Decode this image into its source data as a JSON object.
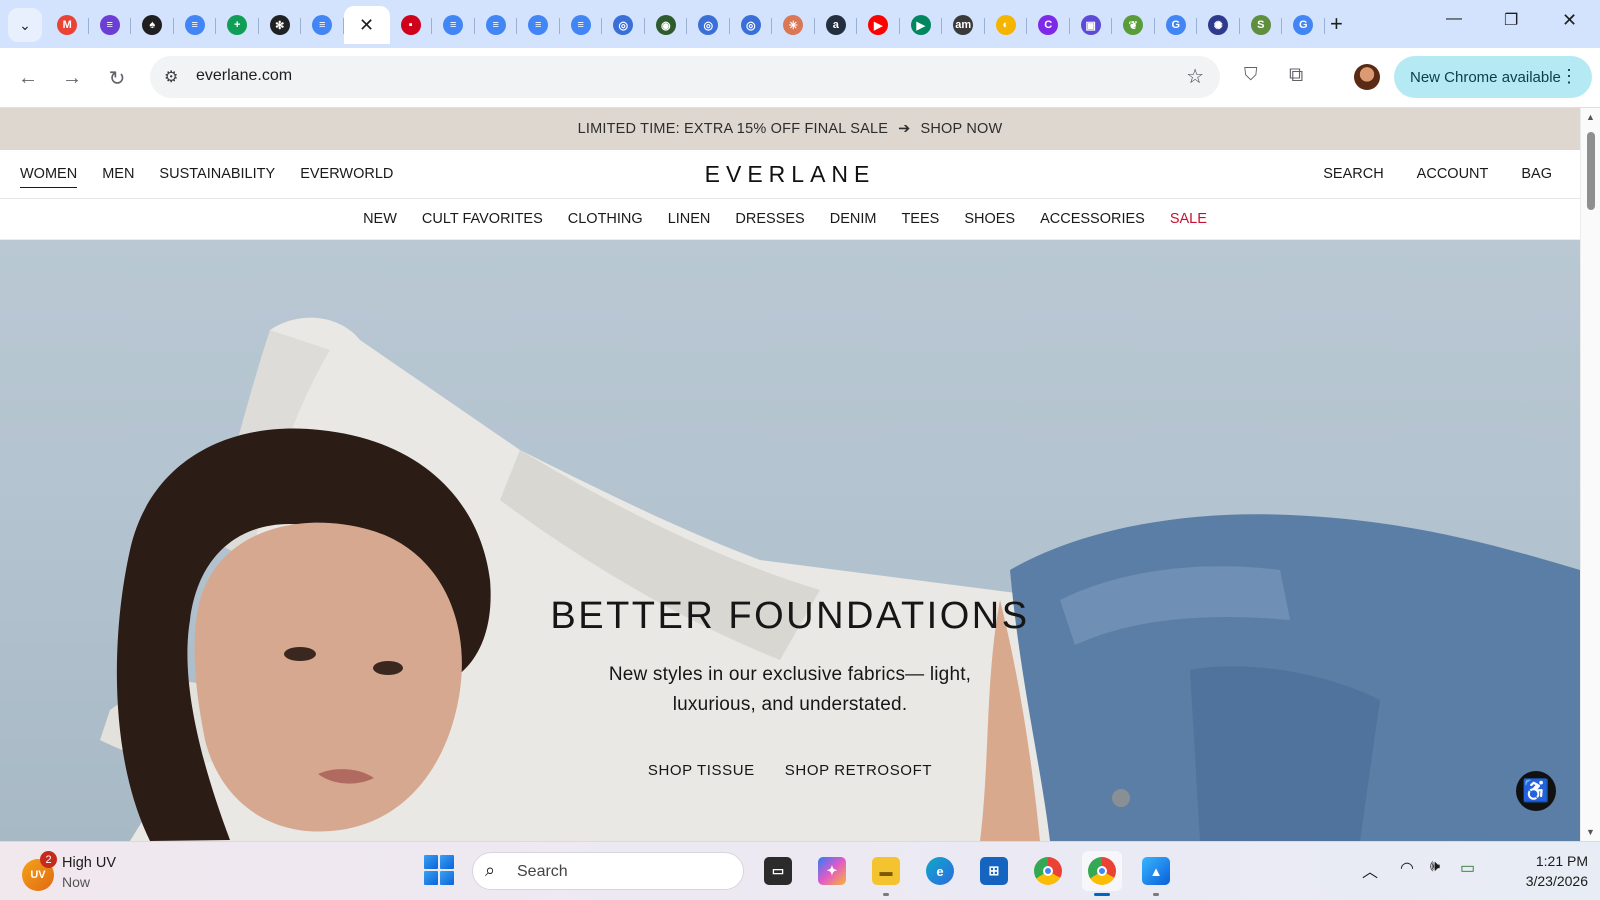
{
  "browser": {
    "tabs": [
      {
        "icon": "gmail-icon",
        "color": "#ea4335",
        "glyph": "M"
      },
      {
        "icon": "purple-app-icon",
        "color": "#6b3fd4",
        "glyph": "≡"
      },
      {
        "icon": "rocket-icon",
        "color": "#1f1f1f",
        "glyph": "♠"
      },
      {
        "icon": "google-docs-icon",
        "color": "#4285f4",
        "glyph": "≡"
      },
      {
        "icon": "google-sheets-icon",
        "color": "#0f9d58",
        "glyph": "+"
      },
      {
        "icon": "chatgpt-icon",
        "color": "#202123",
        "glyph": "✻"
      },
      {
        "icon": "google-docs-icon",
        "color": "#4285f4",
        "glyph": "≡"
      },
      {
        "icon": "active-tab-close-icon",
        "color": "",
        "glyph": "✕",
        "active": true
      },
      {
        "icon": "red-site-icon",
        "color": "#d0021b",
        "glyph": "▪"
      },
      {
        "icon": "google-docs-icon",
        "color": "#4285f4",
        "glyph": "≡"
      },
      {
        "icon": "google-docs-icon",
        "color": "#4285f4",
        "glyph": "≡"
      },
      {
        "icon": "google-docs-icon",
        "color": "#4285f4",
        "glyph": "≡"
      },
      {
        "icon": "google-docs-icon",
        "color": "#4285f4",
        "glyph": "≡"
      },
      {
        "icon": "globe-icon",
        "color": "#3b6fd8",
        "glyph": "◎"
      },
      {
        "icon": "seal-icon",
        "color": "#2d5b2d",
        "glyph": "◉"
      },
      {
        "icon": "globe-icon",
        "color": "#3b6fd8",
        "glyph": "◎"
      },
      {
        "icon": "globe-icon",
        "color": "#3b6fd8",
        "glyph": "◎"
      },
      {
        "icon": "claude-icon",
        "color": "#d97757",
        "glyph": "✳"
      },
      {
        "icon": "amazon-icon",
        "color": "#232f3e",
        "glyph": "a"
      },
      {
        "icon": "youtube-icon",
        "color": "#ff0000",
        "glyph": "▶"
      },
      {
        "icon": "google-play-icon",
        "color": "#01875f",
        "glyph": "▶"
      },
      {
        "icon": "amazon-music-icon",
        "color": "#3a3a3a",
        "glyph": "am"
      },
      {
        "icon": "yellow-app-icon",
        "color": "#f5b400",
        "glyph": "◐"
      },
      {
        "icon": "canva-icon",
        "color": "#7d2ae8",
        "glyph": "C"
      },
      {
        "icon": "printer-icon",
        "color": "#5b4bd6",
        "glyph": "▣"
      },
      {
        "icon": "leaf-icon",
        "color": "#5a9b3a",
        "glyph": "❦"
      },
      {
        "icon": "google-icon",
        "color": "#4285f4",
        "glyph": "G"
      },
      {
        "icon": "gear-seal-icon",
        "color": "#2e3a8c",
        "glyph": "✺"
      },
      {
        "icon": "shopify-icon",
        "color": "#5e8e3e",
        "glyph": "S"
      },
      {
        "icon": "google-icon",
        "color": "#4285f4",
        "glyph": "G"
      }
    ],
    "address": "everlane.com",
    "update_button": "New Chrome available"
  },
  "site": {
    "promo_text": "LIMITED TIME: EXTRA 15% OFF FINAL SALE",
    "promo_arrow": "➔",
    "promo_cta": "SHOP NOW",
    "logo": "EVERLANE",
    "main_nav_left": [
      "WOMEN",
      "MEN",
      "SUSTAINABILITY",
      "EVERWORLD"
    ],
    "main_nav_right": [
      "SEARCH",
      "ACCOUNT",
      "BAG"
    ],
    "sub_nav": [
      "NEW",
      "CULT FAVORITES",
      "CLOTHING",
      "LINEN",
      "DRESSES",
      "DENIM",
      "TEES",
      "SHOES",
      "ACCESSORIES",
      "SALE"
    ],
    "sale_color": "#c8102e",
    "hero": {
      "title": "BETTER FOUNDATIONS",
      "subtitle": "New styles in our exclusive fabrics— light, luxurious, and understated.",
      "link1": "SHOP TISSUE",
      "link2": "SHOP RETROSOFT"
    }
  },
  "taskbar": {
    "weather_badge": "UV",
    "weather_count": "2",
    "weather_title": "High UV",
    "weather_time": "Now",
    "search_label": "Search",
    "time": "1:21 PM",
    "date": "3/23/2026"
  }
}
